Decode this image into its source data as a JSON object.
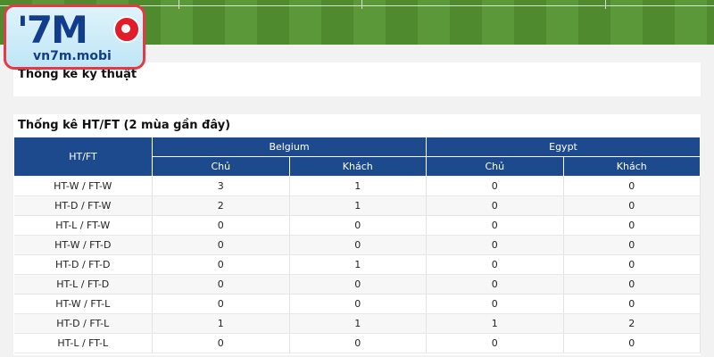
{
  "logo": {
    "mark": "'7M",
    "text": "vn7m.mobi"
  },
  "panel_technical": {
    "title": "Thống kê kỹ thuật"
  },
  "htft": {
    "title": "Thống kê HT/FT (2 mùa gần đây)",
    "header": "HT/FT",
    "teams": [
      {
        "name": "Belgium",
        "home_label": "Chủ",
        "away_label": "Khách"
      },
      {
        "name": "Egypt",
        "home_label": "Chủ",
        "away_label": "Khách"
      }
    ],
    "rows": [
      {
        "label": "HT-W / FT-W",
        "values": [
          "3",
          "1",
          "0",
          "0"
        ]
      },
      {
        "label": "HT-D / FT-W",
        "values": [
          "2",
          "1",
          "0",
          "0"
        ]
      },
      {
        "label": "HT-L / FT-W",
        "values": [
          "0",
          "0",
          "0",
          "0"
        ]
      },
      {
        "label": "HT-W / FT-D",
        "values": [
          "0",
          "0",
          "0",
          "0"
        ]
      },
      {
        "label": "HT-D / FT-D",
        "values": [
          "0",
          "1",
          "0",
          "0"
        ]
      },
      {
        "label": "HT-L / FT-D",
        "values": [
          "0",
          "0",
          "0",
          "0"
        ]
      },
      {
        "label": "HT-W / FT-L",
        "values": [
          "0",
          "0",
          "0",
          "0"
        ]
      },
      {
        "label": "HT-D / FT-L",
        "values": [
          "1",
          "1",
          "1",
          "2"
        ]
      },
      {
        "label": "HT-L / FT-L",
        "values": [
          "0",
          "0",
          "0",
          "0"
        ]
      }
    ]
  },
  "colors": {
    "header_bg": "#1c4a8d",
    "logo_border": "#e53a45",
    "pitch": "#4f8a2f"
  }
}
